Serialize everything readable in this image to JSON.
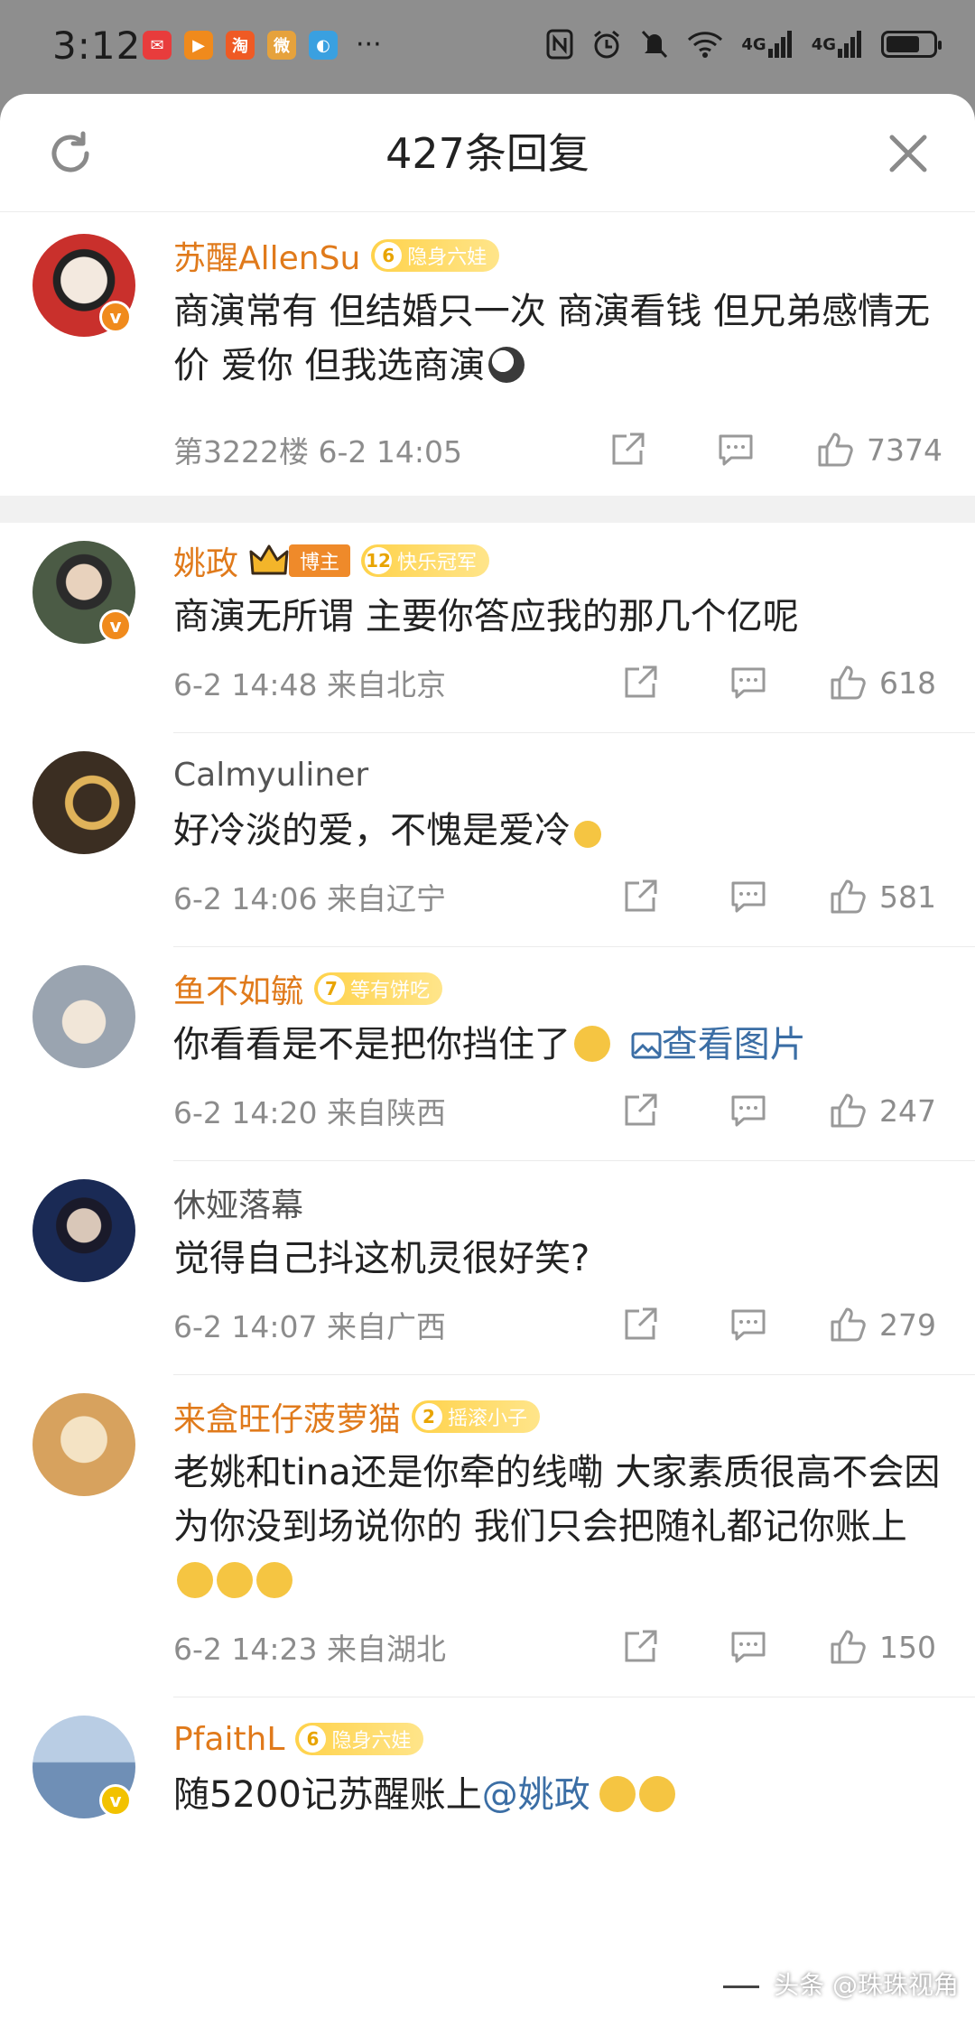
{
  "status_bar": {
    "time": "3:12",
    "app_icons": [
      {
        "name": "mail-app-icon",
        "color": "#e83c3c",
        "glyph": "✉"
      },
      {
        "name": "video-app-icon",
        "color": "#f08a1c",
        "glyph": "▶"
      },
      {
        "name": "taobao-app-icon",
        "color": "#ef5a24",
        "glyph": "淘"
      },
      {
        "name": "weibo-app-icon",
        "color": "#e6a23c",
        "glyph": "微"
      },
      {
        "name": "browser-app-icon",
        "color": "#3aa0e0",
        "glyph": "◐"
      }
    ],
    "more": "···",
    "signal_labels": [
      "4G",
      "4G"
    ]
  },
  "header": {
    "title": "427条回复"
  },
  "comments": [
    {
      "name": "苏醒AllenSu",
      "name_style": "orange",
      "badge_level": "6",
      "badge_text": "隐身六娃",
      "verified": "orange",
      "text": "商演常有 但结婚只一次 商演看钱 但兄弟感情无价 爱你 但我选商演",
      "meta": "第3222楼  6-2 14:05",
      "likes": "7374",
      "avatar_color": "#c9302c"
    },
    {
      "name": "姚政",
      "name_style": "orange",
      "host_badge": "博主",
      "badge_level": "12",
      "badge_text": "快乐冠军",
      "verified": "orange",
      "text": "商演无所谓 主要你答应我的那几个亿呢",
      "meta": "6-2 14:48  来自北京",
      "likes": "618",
      "avatar_color": "#4b5b45"
    },
    {
      "name": "Calmyuliner",
      "name_style": "plain",
      "text": "好冷淡的爱，不愧是爱冷",
      "meta": "6-2 14:06  来自辽宁",
      "likes": "581",
      "avatar_color": "#3b2e22"
    },
    {
      "name": "鱼不如毓",
      "name_style": "orange",
      "badge_level": "7",
      "badge_text": "等有饼吃",
      "text": "你看看是不是把你挡住了",
      "link_text": "查看图片",
      "meta": "6-2 14:20  来自陕西",
      "likes": "247",
      "avatar_color": "#9aa4b0"
    },
    {
      "name": "休娅落幕",
      "name_style": "plain",
      "text": "觉得自己抖这机灵很好笑?",
      "meta": "6-2 14:07  来自广西",
      "likes": "279",
      "avatar_color": "#1a2a55"
    },
    {
      "name": "来盒旺仔菠萝猫",
      "name_style": "orange",
      "badge_level": "2",
      "badge_text": "摇滚小子",
      "text": "老姚和tina还是你牵的线嘞 大家素质很高不会因为你没到场说你的 我们只会把随礼都记你账上",
      "meta": "6-2 14:23  来自湖北",
      "likes": "150",
      "avatar_color": "#d7a25e"
    },
    {
      "name": "PfaithL",
      "name_style": "orange",
      "badge_level": "6",
      "badge_text": "隐身六娃",
      "verified": "yellow",
      "text": "随5200记苏醒账上",
      "mention": "@姚政",
      "avatar_color": "#6f8fb6"
    }
  ],
  "watermark": "头条 @珠珠视角"
}
